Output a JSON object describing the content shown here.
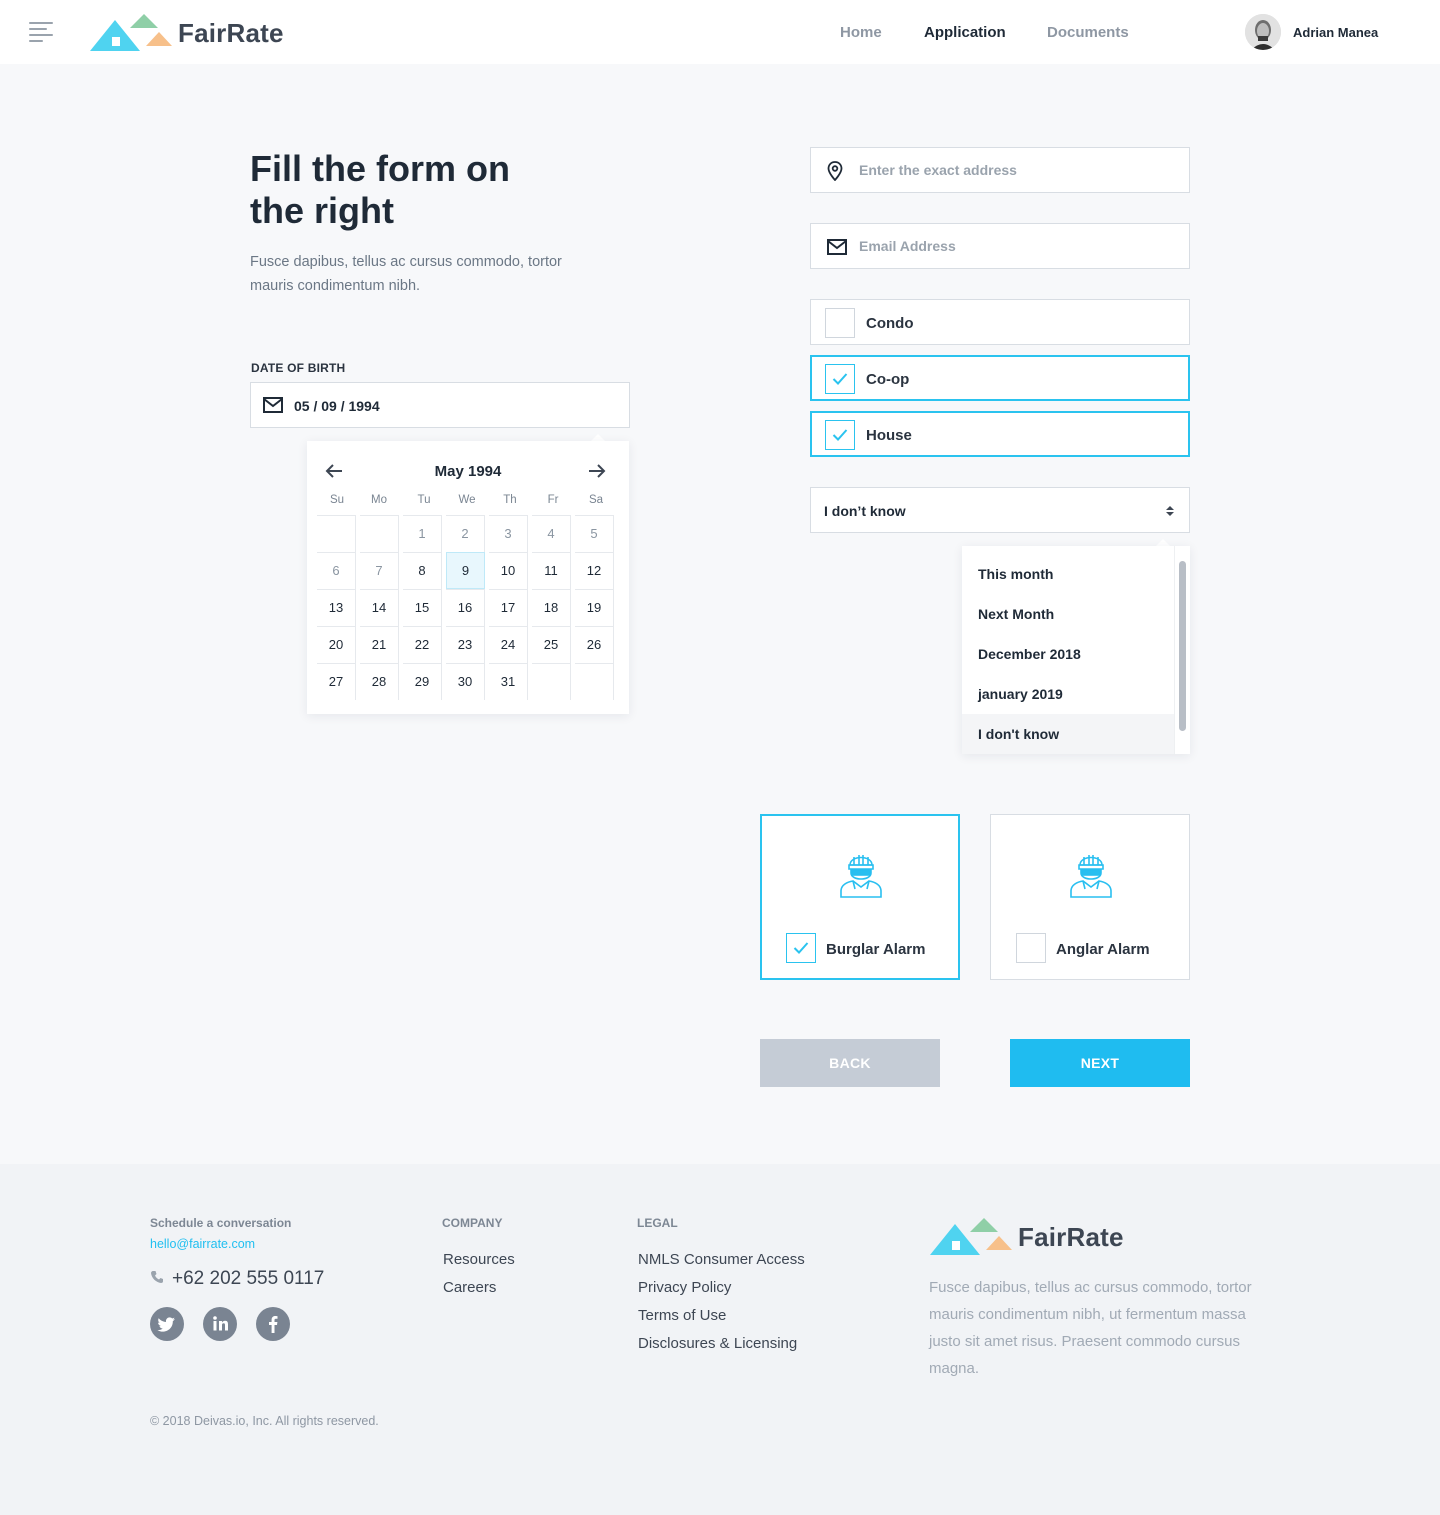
{
  "header": {
    "brand": "FairRate",
    "nav": [
      {
        "label": "Home",
        "active": false
      },
      {
        "label": "Application",
        "active": true
      },
      {
        "label": "Documents",
        "active": false
      }
    ],
    "user_name": "Adrian Manea"
  },
  "intro": {
    "title": "Fill the form on the right",
    "subtitle": "Fusce dapibus, tellus ac cursus commodo, tortor mauris condimentum nibh."
  },
  "dob": {
    "label": "DATE OF BIRTH",
    "value": "05 / 09 / 1994"
  },
  "calendar": {
    "month_label": "May 1994",
    "weekdays": [
      "Su",
      "Mo",
      "Tu",
      "We",
      "Th",
      "Fr",
      "Sa"
    ],
    "weeks": [
      [
        "",
        "",
        "1",
        "2",
        "3",
        "4",
        "5"
      ],
      [
        "6",
        "7",
        "8",
        "9",
        "10",
        "11",
        "12"
      ],
      [
        "13",
        "14",
        "15",
        "16",
        "17",
        "18",
        "19"
      ],
      [
        "20",
        "21",
        "22",
        "23",
        "24",
        "25",
        "26"
      ],
      [
        "27",
        "28",
        "29",
        "30",
        "31",
        "",
        ""
      ]
    ],
    "selected_day": "9",
    "muted_days": [
      "1",
      "2",
      "3",
      "4",
      "5",
      "6",
      "7"
    ]
  },
  "form": {
    "address_placeholder": "Enter the exact address",
    "email_placeholder": "Email Address",
    "property_types": [
      {
        "label": "Condo",
        "checked": false
      },
      {
        "label": "Co-op",
        "checked": true
      },
      {
        "label": "House",
        "checked": true
      }
    ],
    "timing": {
      "value": "I don’t know",
      "options": [
        {
          "label": "This month",
          "highlighted": false
        },
        {
          "label": "Next Month",
          "highlighted": false
        },
        {
          "label": "December 2018",
          "highlighted": false
        },
        {
          "label": "january 2019",
          "highlighted": false
        },
        {
          "label": "I don't know",
          "highlighted": true
        }
      ]
    },
    "alarms": [
      {
        "label": "Burglar Alarm",
        "checked": true,
        "icon": "burglar-icon"
      },
      {
        "label": "Anglar Alarm",
        "checked": false,
        "icon": "burglar-icon"
      }
    ],
    "back_label": "BACK",
    "next_label": "NEXT"
  },
  "footer": {
    "schedule_label": "Schedule a conversation",
    "email": "hello@fairrate.com",
    "phone": "+62 202 555 0117",
    "social": [
      "twitter-icon",
      "linkedin-icon",
      "facebook-icon"
    ],
    "company_heading": "COMPANY",
    "company_links": [
      "Resources",
      "Careers"
    ],
    "legal_heading": "LEGAL",
    "legal_links": [
      "NMLS Consumer Access",
      "Privacy Policy",
      "Terms of Use",
      "Disclosures & Licensing"
    ],
    "brand": "FairRate",
    "description": "Fusce dapibus, tellus ac cursus commodo, tortor mauris condimentum nibh, ut fermentum massa justo sit amet risus. Praesent commodo cursus magna.",
    "copyright": "© 2018 Deivas.io, Inc. All rights reserved."
  },
  "colors": {
    "accent": "#1fbcf0",
    "border_active": "#2ac3ef",
    "back_button": "#c5ccd6",
    "logo_blue": "#4fd3f0",
    "logo_green": "#8fcfa7",
    "logo_orange": "#f7c08a"
  }
}
